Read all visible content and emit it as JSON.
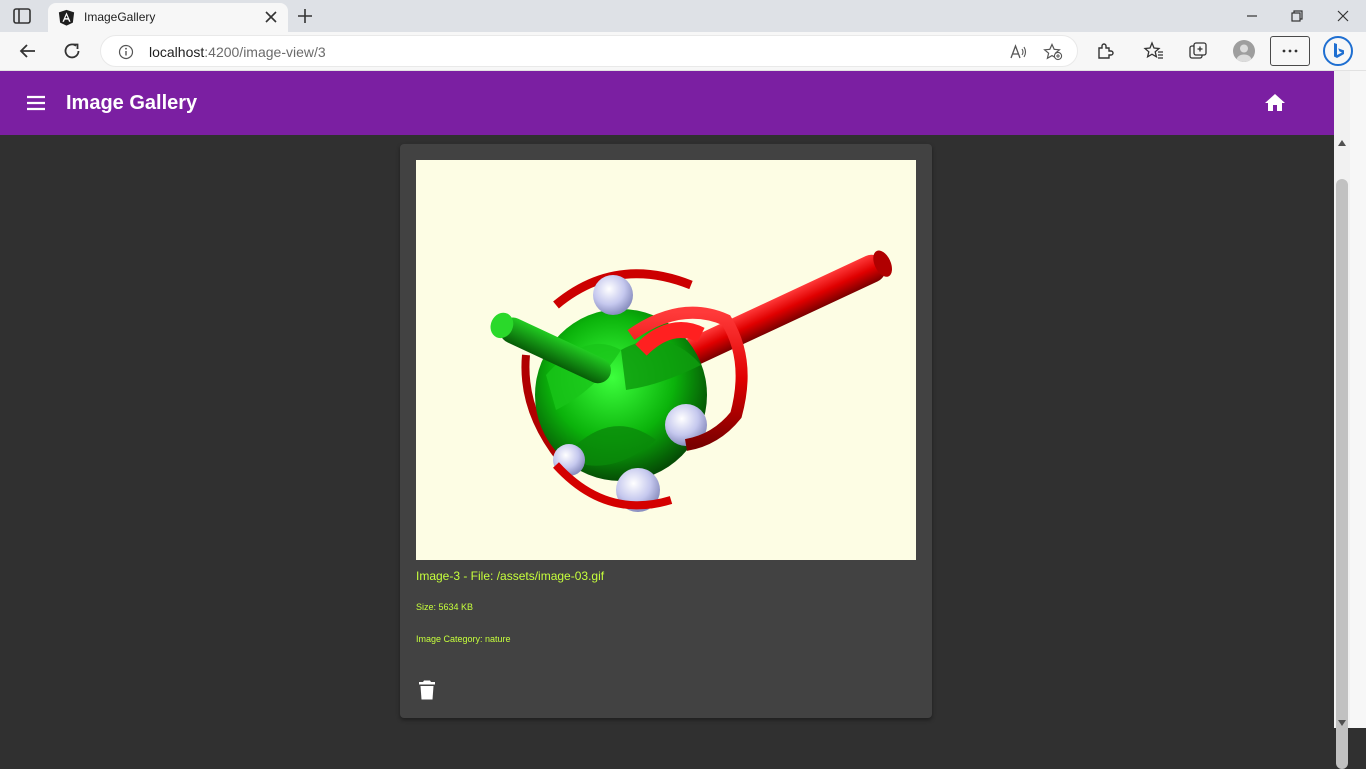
{
  "browser": {
    "tab_title": "ImageGallery",
    "url_host": "localhost",
    "url_path": ":4200/image-view/3"
  },
  "app": {
    "title": "Image Gallery",
    "colors": {
      "toolbar": "#7b1fa2",
      "caption": "#c6ff3c",
      "background": "#303030",
      "card": "#424242"
    }
  },
  "image_card": {
    "caption": "Image-3 - File: /assets/image-03.gif",
    "size": "Size: 5634 KB",
    "category": "Image Category: nature"
  },
  "icons": {
    "menu": "menu-icon",
    "home": "home-icon",
    "delete": "delete-icon"
  }
}
